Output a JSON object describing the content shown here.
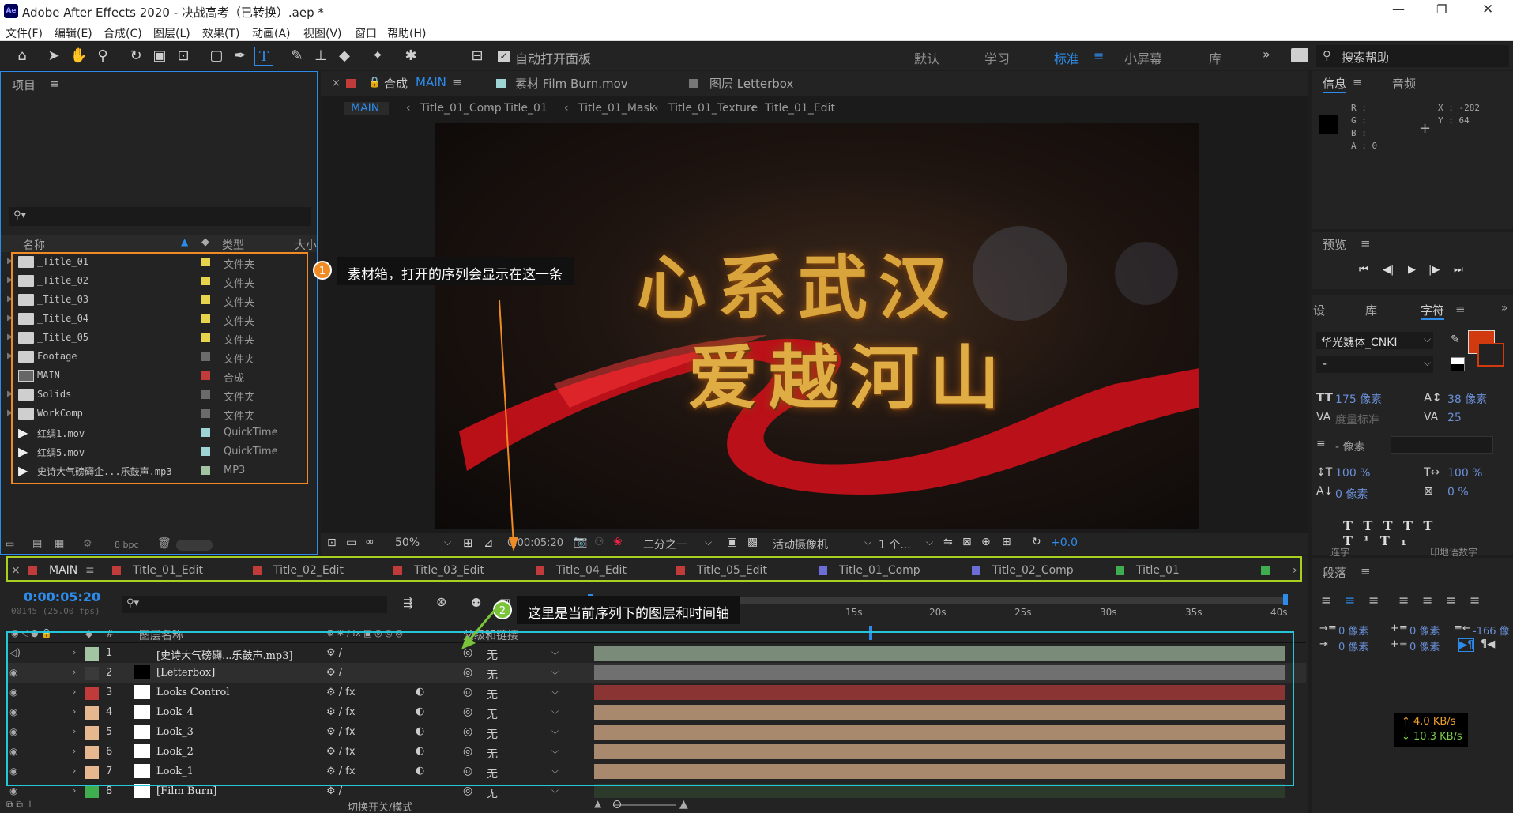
{
  "window": {
    "title": "Adobe After Effects 2020 - 决战高考（已转换）.aep *",
    "app_icon": "Ae"
  },
  "menu": [
    "文件(F)",
    "编辑(E)",
    "合成(C)",
    "图层(L)",
    "效果(T)",
    "动画(A)",
    "视图(V)",
    "窗口",
    "帮助(H)"
  ],
  "toolbar": {
    "auto_open_label": "自动打开面板",
    "workspaces": [
      "默认",
      "学习",
      "标准",
      "小屏幕",
      "库"
    ],
    "active_workspace": "标准",
    "search_placeholder": "搜索帮助"
  },
  "project": {
    "title": "项目",
    "search_placeholder": "",
    "col_name": "名称",
    "col_type": "类型",
    "col_size": "大小",
    "items": [
      {
        "name": "_Title_01",
        "type": "文件夹",
        "color": "#e8d44c",
        "icon": "folder-icon"
      },
      {
        "name": "_Title_02",
        "type": "文件夹",
        "color": "#e8d44c",
        "icon": "folder-icon"
      },
      {
        "name": "_Title_03",
        "type": "文件夹",
        "color": "#e8d44c",
        "icon": "folder-icon"
      },
      {
        "name": "_Title_04",
        "type": "文件夹",
        "color": "#e8d44c",
        "icon": "folder-icon"
      },
      {
        "name": "_Title_05",
        "type": "文件夹",
        "color": "#e8d44c",
        "icon": "folder-icon"
      },
      {
        "name": "Footage",
        "type": "文件夹",
        "color": "#6b6b6b",
        "icon": "folder-icon"
      },
      {
        "name": "MAIN",
        "type": "合成",
        "color": "#c23b3b",
        "icon": "composition-icon"
      },
      {
        "name": "Solids",
        "type": "文件夹",
        "color": "#6b6b6b",
        "icon": "folder-icon"
      },
      {
        "name": "WorkComp",
        "type": "文件夹",
        "color": "#6b6b6b",
        "icon": "folder-icon"
      },
      {
        "name": "红绸1.mov",
        "type": "QuickTime",
        "color": "#9fd4d4",
        "icon": "video-file-icon"
      },
      {
        "name": "红绸5.mov",
        "type": "QuickTime",
        "color": "#9fd4d4",
        "icon": "video-file-icon"
      },
      {
        "name": "史诗大气磅礴企...乐鼓声.mp3",
        "type": "MP3",
        "color": "#a3c4a3",
        "icon": "audio-file-icon"
      }
    ],
    "bpc": "8 bpc"
  },
  "annotations": {
    "a1_num": "1",
    "a1_text": "素材箱，打开的序列会显示在这一条",
    "a2_num": "2",
    "a2_text": "这里是当前序列下的图层和时间轴"
  },
  "viewer": {
    "tabs": [
      {
        "label": "合成 MAIN",
        "prefix": "合成",
        "name": "MAIN"
      },
      {
        "label": "素材 Film Burn.mov"
      },
      {
        "label": "图层 Letterbox"
      }
    ],
    "breadcrumbs": [
      "MAIN",
      "Title_01_Comp",
      "Title_01",
      "Title_01_Mask",
      "Title_01_Texture",
      "Title_01_Edit"
    ],
    "headline_line1": "心系武汉",
    "headline_line2": "爱越河山",
    "zoom": "50%",
    "timecode": "0:00:05:20",
    "resolution": "二分之一",
    "camera": "活动摄像机",
    "views": "1 个...",
    "exposure": "+0.0"
  },
  "info": {
    "tab_info": "信息",
    "tab_audio": "音频",
    "r": "R :",
    "g": "G :",
    "b": "B :",
    "a": "A : 0",
    "x": "X : -282",
    "y": "Y : 64"
  },
  "preview": {
    "title": "预览"
  },
  "character": {
    "tab_settings": "设",
    "tab_lib": "库",
    "tab_char": "字符",
    "font": "华光魏体_CNKI",
    "style": "-",
    "size": "175 像素",
    "leading": "38 像素",
    "kerning": "度量标准",
    "tracking": "25",
    "stroke": "- 像素",
    "vscale": "100 %",
    "hscale": "100 %",
    "baseline": "0 像素",
    "tsume": "0 %",
    "opt1": "连字",
    "opt2": "印地语数字",
    "fill_color": "#d13a0e"
  },
  "paragraph": {
    "title": "段落",
    "indent_left": "0 像素",
    "indent_first": "0 像素",
    "space_before": "0 像素",
    "space_after": "0 像素",
    "indent_right": "-166 像",
    "net_up": "↑ 4.0 KB/s",
    "net_down": "↓ 10.3 KB/s"
  },
  "timeline": {
    "tabs": [
      {
        "label": "MAIN",
        "color": "#c23b3b"
      },
      {
        "label": "Title_01_Edit",
        "color": "#c23b3b"
      },
      {
        "label": "Title_02_Edit",
        "color": "#c23b3b"
      },
      {
        "label": "Title_03_Edit",
        "color": "#c23b3b"
      },
      {
        "label": "Title_04_Edit",
        "color": "#c23b3b"
      },
      {
        "label": "Title_05_Edit",
        "color": "#c23b3b"
      },
      {
        "label": "Title_01_Comp",
        "color": "#6d6dd8"
      },
      {
        "label": "Title_02_Comp",
        "color": "#6d6dd8"
      },
      {
        "label": "Title_01",
        "color": "#3fae4f"
      }
    ],
    "timecode": "0:00:05:20",
    "frame_info": "00145 (25.00 fps)",
    "ruler": [
      "15s",
      "20s",
      "25s",
      "30s",
      "35s",
      "40s"
    ],
    "col_layer_name": "图层名称",
    "col_parent": "父级和链接",
    "layers": [
      {
        "num": "1",
        "name": "[史诗大气磅礴...乐鼓声.mp3]",
        "label": "#a3c4a3",
        "parent": "无",
        "bar": "#7a8b7a"
      },
      {
        "num": "2",
        "name": "[Letterbox]",
        "label": "#3a3a3a",
        "parent": "无",
        "bar": "#707070"
      },
      {
        "num": "3",
        "name": "Looks Control",
        "label": "#c23b3b",
        "parent": "无",
        "bar": "#8b3434"
      },
      {
        "num": "4",
        "name": "Look_4",
        "label": "#e6b88f",
        "parent": "无",
        "bar": "#a8896e"
      },
      {
        "num": "5",
        "name": "Look_3",
        "label": "#e6b88f",
        "parent": "无",
        "bar": "#a8896e"
      },
      {
        "num": "6",
        "name": "Look_2",
        "label": "#e6b88f",
        "parent": "无",
        "bar": "#a8896e"
      },
      {
        "num": "7",
        "name": "Look_1",
        "label": "#e6b88f",
        "parent": "无",
        "bar": "#a8896e"
      },
      {
        "num": "8",
        "name": "[Film Burn]",
        "label": "#3fae4f",
        "parent": "无",
        "bar": "#2c3a2c"
      }
    ],
    "footer": "切换开关/模式"
  }
}
